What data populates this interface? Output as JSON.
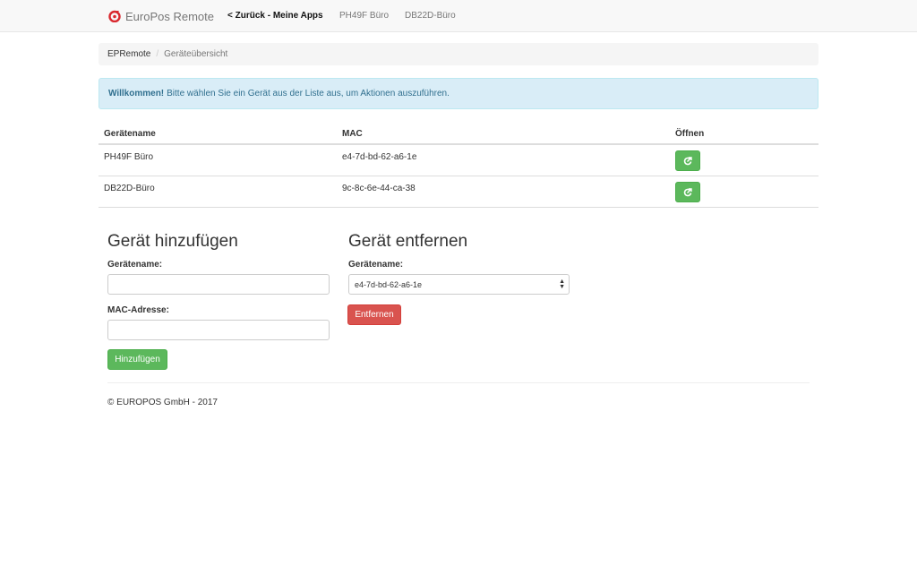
{
  "navbar": {
    "brand": "EuroPos Remote",
    "links": [
      {
        "label": "< Zurück - Meine Apps",
        "active": true
      },
      {
        "label": "PH49F Büro",
        "active": false
      },
      {
        "label": "DB22D-Büro",
        "active": false
      }
    ]
  },
  "breadcrumb": {
    "root": "EPRemote",
    "separator": "/",
    "current": "Geräteübersicht"
  },
  "alert": {
    "strong": "Willkommen!",
    "text": "Bitte wählen Sie ein Gerät aus der Liste aus, um Aktionen auszuführen."
  },
  "devices_table": {
    "headers": [
      "Gerätename",
      "MAC",
      "Öffnen"
    ],
    "rows": [
      {
        "name": "PH49F Büro",
        "mac": "e4-7d-bd-62-a6-1e"
      },
      {
        "name": "DB22D-Büro",
        "mac": "9c-8c-6e-44-ca-38"
      }
    ]
  },
  "add_device": {
    "title": "Gerät hinzufügen",
    "name_label": "Gerätename:",
    "name_value": "",
    "mac_label": "MAC-Adresse:",
    "mac_value": "",
    "submit_label": "Hinzufügen"
  },
  "remove_device": {
    "title": "Gerät entfernen",
    "name_label": "Gerätename:",
    "selected": "e4-7d-bd-62-a6-1e",
    "submit_label": "Entfernen"
  },
  "footer": {
    "text": "© EUROPOS GmbH - 2017"
  },
  "colors": {
    "success": "#5cb85c",
    "danger": "#d9534f",
    "info_bg": "#d9edf7",
    "info_text": "#31708f",
    "brand_red": "#d9282e"
  },
  "icons": {
    "brand": "europos-logo-icon",
    "open": "open-external-icon",
    "select": "select-updown-icon"
  }
}
